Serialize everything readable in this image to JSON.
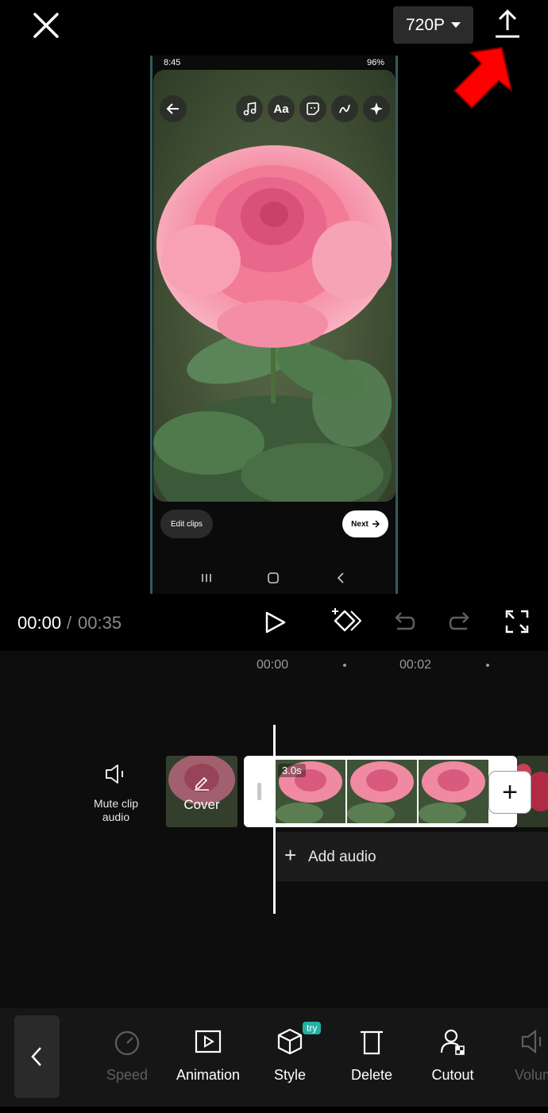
{
  "topbar": {
    "resolution_label": "720P"
  },
  "preview": {
    "status_time": "8:45",
    "status_battery": "96%",
    "edit_clips_label": "Edit clips",
    "next_label": "Next"
  },
  "playback": {
    "current_time": "00:00",
    "separator": "/",
    "total_time": "00:35"
  },
  "timeline": {
    "ticks": [
      "00:00",
      "00:02"
    ],
    "mute_label": "Mute clip audio",
    "cover_label": "Cover",
    "clip_duration": "3.0s",
    "add_clip_symbol": "+",
    "add_audio_label": "Add audio"
  },
  "toolbar": {
    "items": [
      {
        "label": "Speed",
        "icon": "speed-icon",
        "enabled": false
      },
      {
        "label": "Animation",
        "icon": "animation-icon",
        "enabled": true
      },
      {
        "label": "Style",
        "icon": "style-cube-icon",
        "enabled": true,
        "badge": "try"
      },
      {
        "label": "Delete",
        "icon": "trash-icon",
        "enabled": true
      },
      {
        "label": "Cutout",
        "icon": "cutout-icon",
        "enabled": true
      },
      {
        "label": "Volum",
        "icon": "volume-icon",
        "enabled": false
      }
    ]
  },
  "colors": {
    "accent_teal": "#22b2a4",
    "annotation_red": "#ff0000",
    "background": "#000000"
  }
}
